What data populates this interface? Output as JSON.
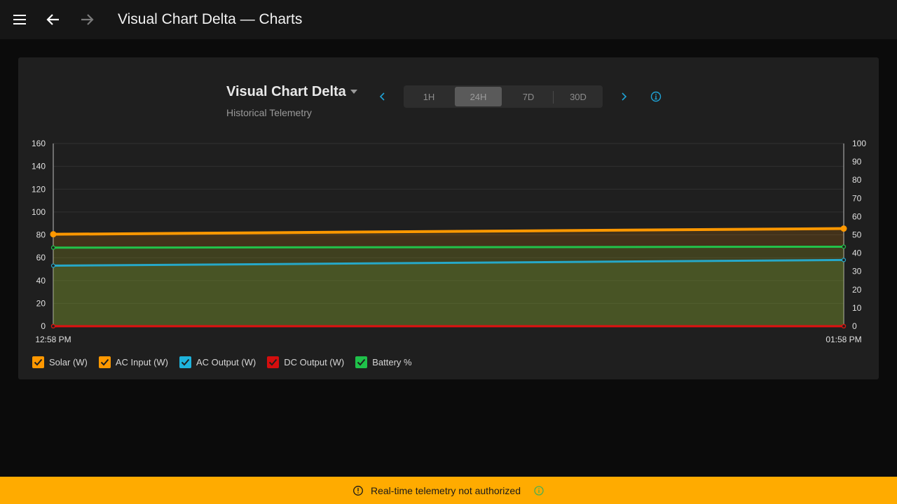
{
  "header": {
    "title": "Visual Chart Delta — Charts",
    "menu_icon": "menu-icon",
    "back_icon": "arrow-left-icon",
    "forward_icon": "arrow-right-icon"
  },
  "panel": {
    "title": "Visual Chart Delta",
    "subtitle": "Historical Telemetry",
    "ranges": [
      "1H",
      "24H",
      "7D",
      "30D"
    ],
    "selected_range": "24H"
  },
  "chart_data": {
    "type": "area",
    "x": [
      "12:58 PM",
      "01:58 PM"
    ],
    "y_left": {
      "ticks": [
        0,
        20,
        40,
        60,
        80,
        100,
        120,
        140,
        160
      ],
      "ylim": [
        0,
        160
      ]
    },
    "y_right": {
      "ticks": [
        0,
        10,
        20,
        30,
        40,
        50,
        60,
        70,
        80,
        90,
        100
      ],
      "ylim": [
        0,
        100
      ]
    },
    "grid": true,
    "series": [
      {
        "name": "Solar (W)",
        "axis": "left",
        "color": "#ff9800",
        "values": [
          0,
          0
        ]
      },
      {
        "name": "AC Input (W)",
        "axis": "left",
        "color": "#ff9800",
        "values": [
          80.5,
          85.5
        ]
      },
      {
        "name": "AC Output (W)",
        "axis": "left",
        "color": "#26a8c8",
        "values": [
          53,
          58
        ]
      },
      {
        "name": "DC Output (W)",
        "axis": "left",
        "color": "#e01010",
        "values": [
          0,
          0
        ]
      },
      {
        "name": "Battery %",
        "axis": "right",
        "color": "#22c24a",
        "values": [
          43,
          43.5
        ]
      }
    ]
  },
  "legend": [
    {
      "label": "Solar (W)",
      "color": "#ff9800",
      "checked": true
    },
    {
      "label": "AC Input (W)",
      "color": "#ff9800",
      "checked": true
    },
    {
      "label": "AC Output (W)",
      "color": "#1eb3dc",
      "checked": true
    },
    {
      "label": "DC Output (W)",
      "color": "#d40e0e",
      "checked": true
    },
    {
      "label": "Battery %",
      "color": "#1fc14a",
      "checked": true
    }
  ],
  "banner": {
    "text": "Real-time telemetry not authorized",
    "color": "#ffab00"
  }
}
